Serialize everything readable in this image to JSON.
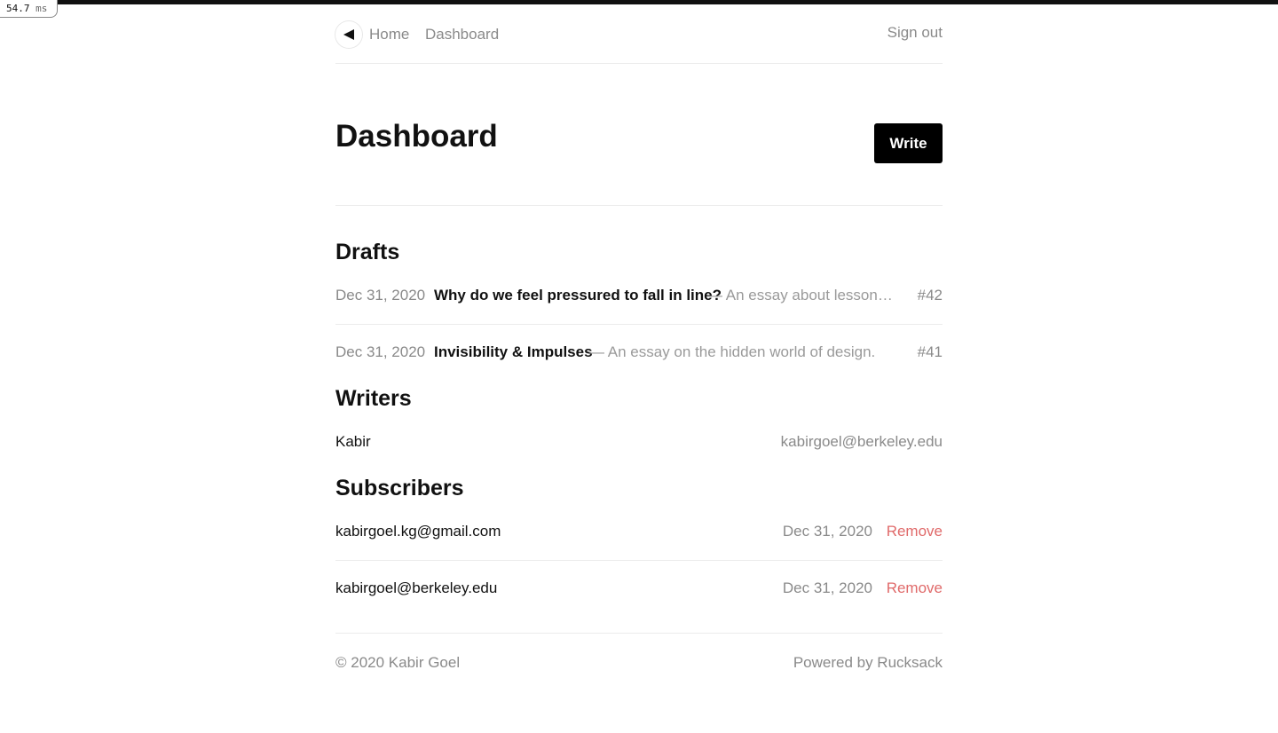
{
  "timer": {
    "value": "54.7",
    "unit": "ms"
  },
  "nav": {
    "logo_icon": "triangle-left-icon",
    "home": "Home",
    "dashboard": "Dashboard",
    "sign_out": "Sign out"
  },
  "header": {
    "title": "Dashboard",
    "write_label": "Write"
  },
  "drafts": {
    "title": "Drafts",
    "items": [
      {
        "date": "Dec 31, 2020",
        "title": "Why do we feel pressured to fall in line?",
        "description": "— An essay about lessons l…",
        "number": "#42"
      },
      {
        "date": "Dec 31, 2020",
        "title": "Invisibility & Impulses",
        "description": "— An essay on the hidden world of design.",
        "number": "#41"
      }
    ]
  },
  "writers": {
    "title": "Writers",
    "items": [
      {
        "name": "Kabir",
        "email": "kabirgoel@berkeley.edu"
      }
    ]
  },
  "subscribers": {
    "title": "Subscribers",
    "items": [
      {
        "email": "kabirgoel.kg@gmail.com",
        "date": "Dec 31, 2020",
        "action": "Remove"
      },
      {
        "email": "kabirgoel@berkeley.edu",
        "date": "Dec 31, 2020",
        "action": "Remove"
      }
    ]
  },
  "footer": {
    "copyright": "© 2020 Kabir Goel",
    "powered_by": "Powered by Rucksack"
  },
  "colors": {
    "accent": "#000000",
    "danger": "#e06a6a",
    "muted": "#8a8a8a"
  }
}
